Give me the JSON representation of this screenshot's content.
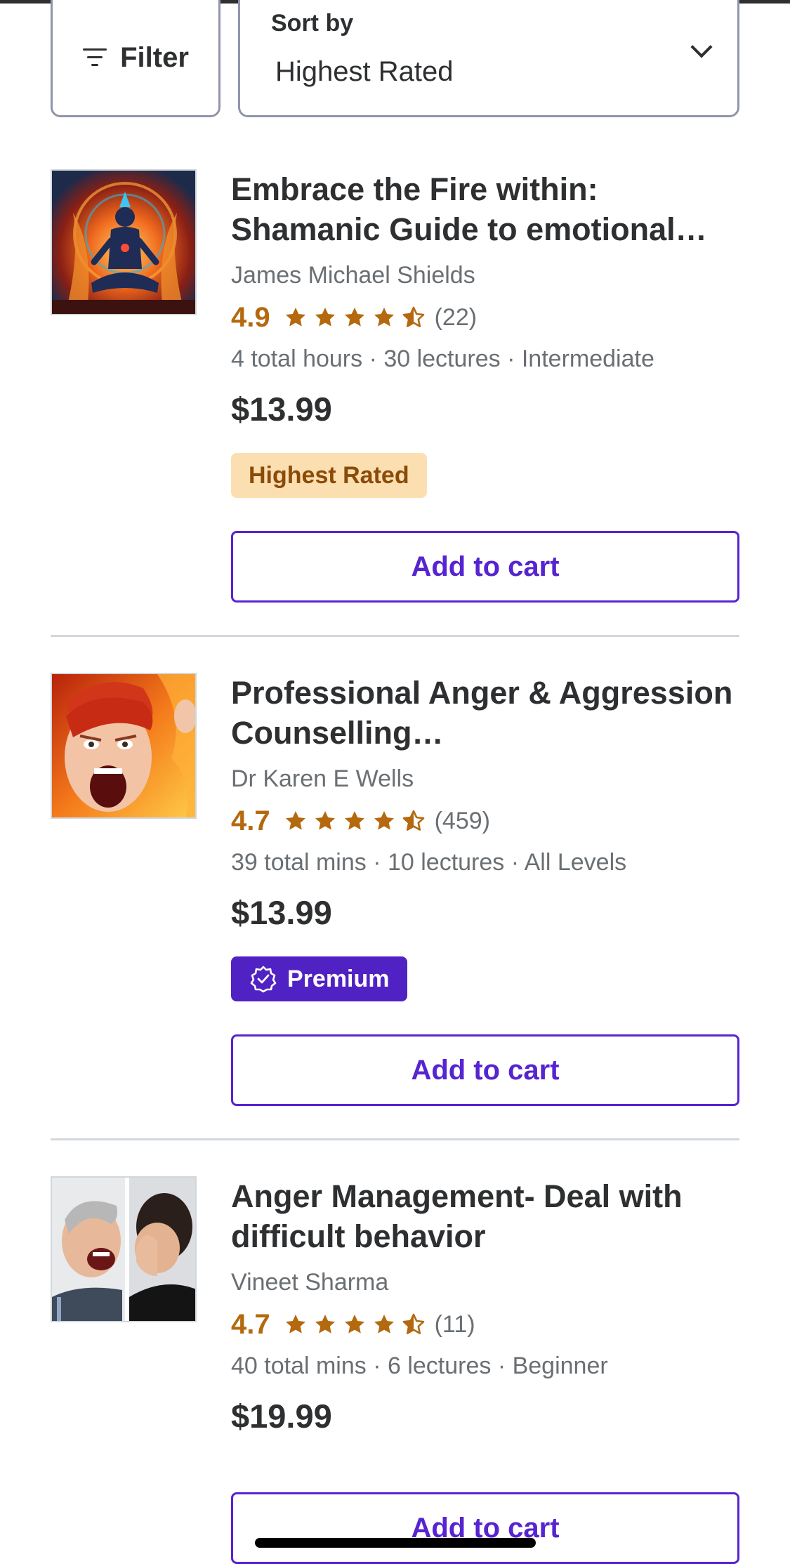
{
  "toolbar": {
    "filter_label": "Filter",
    "sort_label": "Sort by",
    "sort_value": "Highest Rated"
  },
  "courses": [
    {
      "title": "Embrace the Fire within: Shamanic Guide to emotional…",
      "instructor": "James Michael Shields",
      "rating": "4.9",
      "rating_value": 4.9,
      "reviews": "(22)",
      "meta": "4 total hours · 30 lectures · Intermediate",
      "price": "$13.99",
      "badge": "Highest Rated",
      "cart": "Add to cart"
    },
    {
      "title": "Professional Anger & Aggression Counselling…",
      "instructor": "Dr Karen E Wells",
      "rating": "4.7",
      "rating_value": 4.7,
      "reviews": "(459)",
      "meta": "39 total mins · 10 lectures · All Levels",
      "price": "$13.99",
      "badge": "Premium",
      "cart": "Add to cart"
    },
    {
      "title": "Anger Management- Deal with difficult behavior",
      "instructor": "Vineet Sharma",
      "rating": "4.7",
      "rating_value": 4.7,
      "reviews": "(11)",
      "meta": "40 total mins · 6 lectures · Beginner",
      "price": "$19.99",
      "cart": "Add to cart"
    }
  ],
  "colors": {
    "accent": "#5624d0",
    "rating": "#b4690e",
    "premium": "#5022c3",
    "highest_rated_bg": "#fcdfb1"
  }
}
